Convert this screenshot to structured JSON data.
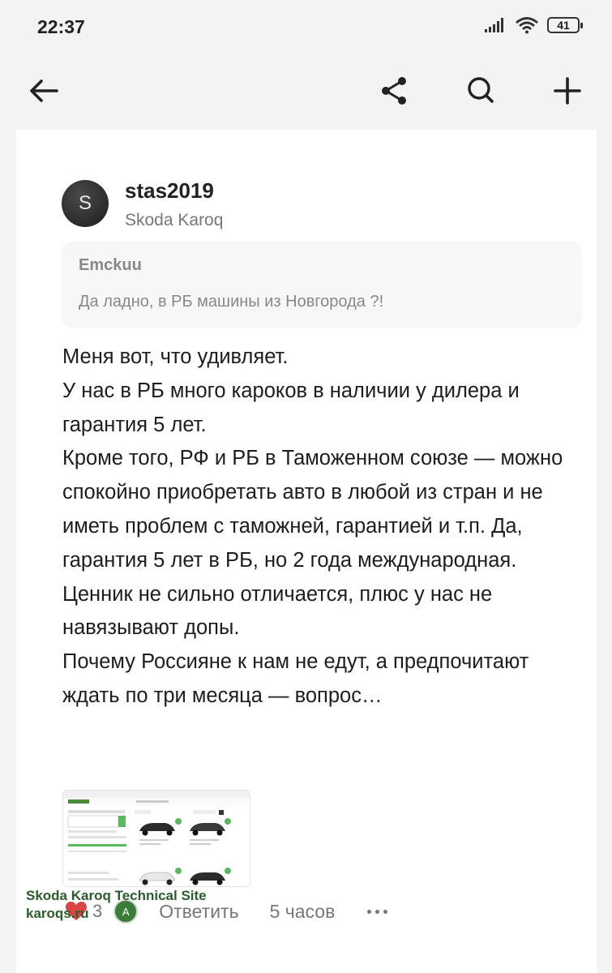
{
  "status_bar": {
    "time": "22:37",
    "battery": "41"
  },
  "post": {
    "username": "stas2019",
    "user_car": "Skoda Karoq",
    "avatar_letter": "S",
    "quote": {
      "author": "Emckuu",
      "text": "Да ладно, в РБ машины из Новгорода ?!"
    },
    "lines": [
      "Меня вот, что удивляет.",
      "У нас в РБ много кароков в наличии у дилера и гарантия 5 лет.",
      "Кроме того, РФ и РБ в Таможенном союзе — можно спокойно приобретать авто в любой из стран и не иметь проблем с таможней, гарантией и т.п. Да, гарантия 5 лет в РБ, но 2 года международная.",
      "Ценник не сильно отличается, плюс у нас не навязывают допы.",
      "Почему Россияне к нам не едут, а предпочитают ждать по три месяца — вопрос…"
    ],
    "likes": "3",
    "liker_letter": "A",
    "reply_label": "Ответить",
    "time_ago": "5 часов"
  },
  "watermark": {
    "line1": "Skoda Karoq Technical Site",
    "line2": "karoqs.ru"
  },
  "colors": {
    "accent_green": "#5cb85c",
    "text_muted": "#777777"
  }
}
